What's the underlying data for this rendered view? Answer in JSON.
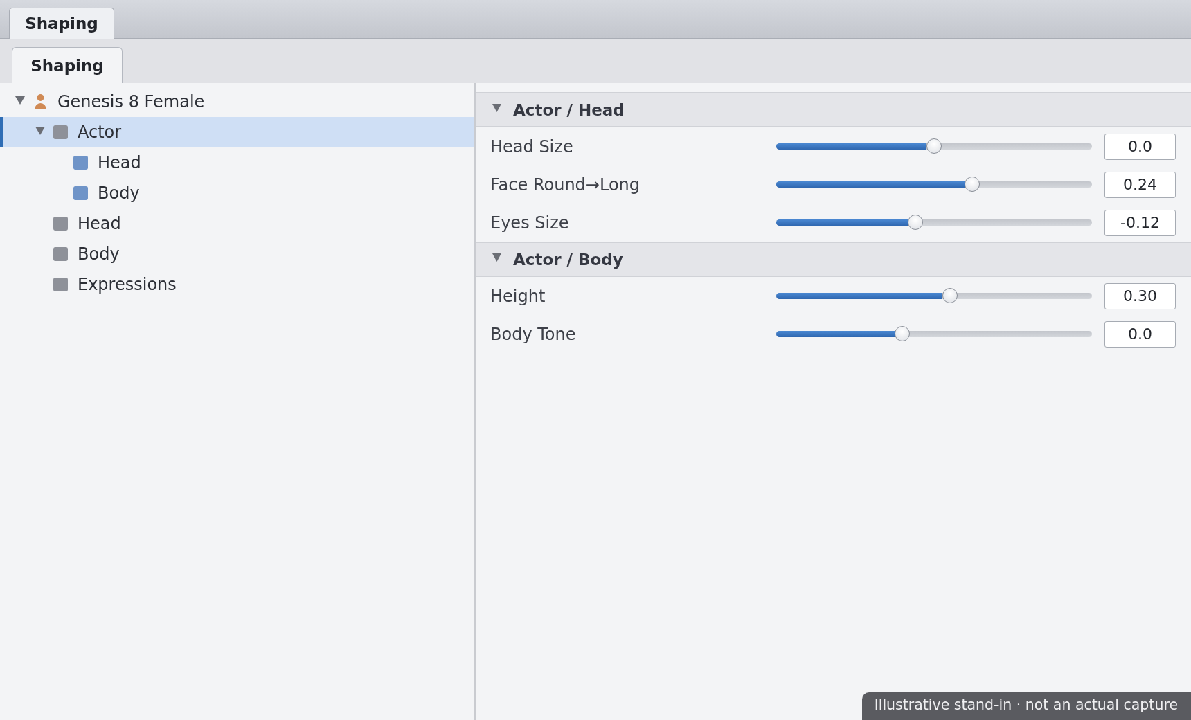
{
  "document_tabs": [
    {
      "label": "Shaping",
      "selected": true
    }
  ],
  "panel_tabs": [
    {
      "label": "Shaping",
      "selected": true
    }
  ],
  "scene_tree": [
    {
      "label": "Genesis 8 Female",
      "kind": "figure",
      "expanded": true,
      "selected": false,
      "children": [
        {
          "label": "Actor",
          "kind": "group",
          "expanded": true,
          "selected": true,
          "children": [
            {
              "label": "Head",
              "kind": "item",
              "selected": false
            },
            {
              "label": "Body",
              "kind": "item",
              "selected": false
            }
          ]
        },
        {
          "label": "Head",
          "kind": "group",
          "selected": false
        },
        {
          "label": "Body",
          "kind": "group",
          "selected": false
        },
        {
          "label": "Expressions",
          "kind": "group",
          "selected": false
        }
      ]
    }
  ],
  "sections": [
    {
      "title": "Actor / Head",
      "expanded": true,
      "properties": [
        {
          "label": "Head Size",
          "level": 0.5,
          "value": "0.0"
        },
        {
          "label": "Face Round→Long",
          "level": 0.62,
          "value": "0.24"
        },
        {
          "label": "Eyes Size",
          "level": 0.44,
          "value": "-0.12"
        }
      ]
    },
    {
      "title": "Actor / Body",
      "expanded": true,
      "properties": [
        {
          "label": "Height",
          "level": 0.55,
          "value": "0.30"
        },
        {
          "label": "Body Tone",
          "level": 0.4,
          "value": "0.0"
        }
      ]
    }
  ],
  "notice": "Illustrative stand-in · not an actual capture"
}
